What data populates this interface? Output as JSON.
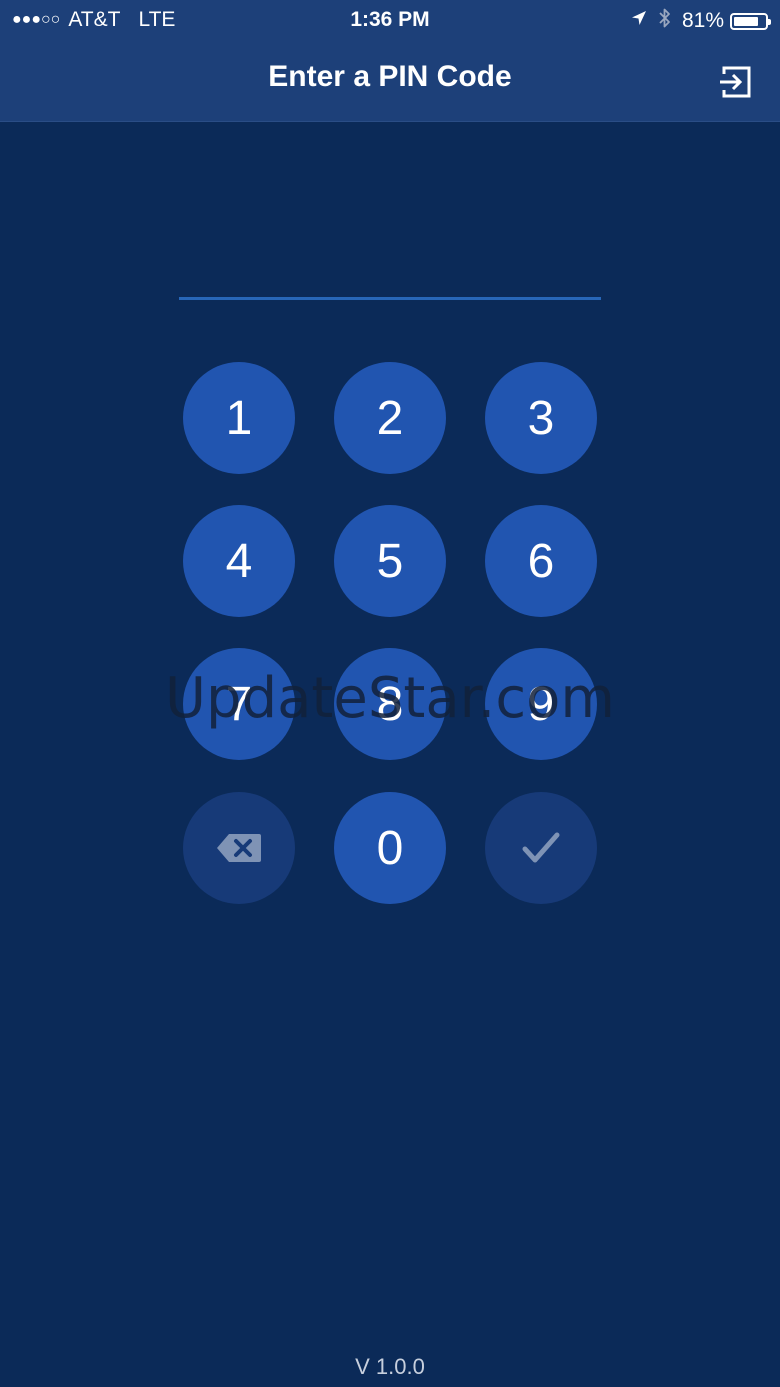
{
  "status_bar": {
    "signal": "●●●○○",
    "carrier": "AT&T",
    "network": "LTE",
    "time": "1:36 PM",
    "location_icon": "location-arrow-icon",
    "bluetooth_icon": "bluetooth-icon",
    "battery_percent": "81%",
    "battery_level": 0.81
  },
  "header": {
    "title": "Enter a PIN Code",
    "logout_icon": "logout-icon"
  },
  "pin": {
    "value": ""
  },
  "keypad": {
    "k1": "1",
    "k2": "2",
    "k3": "3",
    "k4": "4",
    "k5": "5",
    "k6": "6",
    "k7": "7",
    "k8": "8",
    "k9": "9",
    "k0": "0",
    "delete_icon": "backspace-icon",
    "confirm_icon": "checkmark-icon"
  },
  "watermark": "UpdateStar.com",
  "footer": {
    "version": "V 1.0.0"
  },
  "colors": {
    "background": "#0b2a58",
    "header": "#1d4079",
    "key": "#2155b0",
    "key_disabled": "#173a78",
    "pin_line": "#2766b8"
  }
}
